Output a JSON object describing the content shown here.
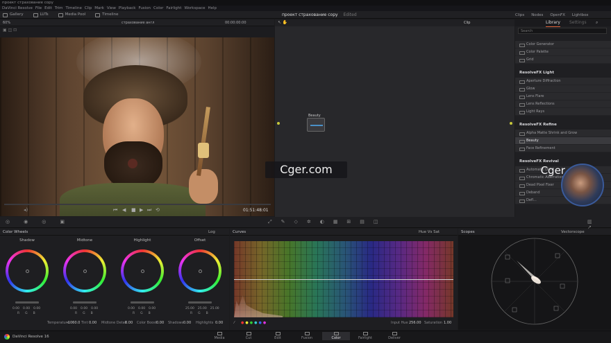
{
  "window": {
    "title": "проект страхование copy"
  },
  "menu": [
    "DaVinci Resolve",
    "File",
    "Edit",
    "Trim",
    "Timeline",
    "Clip",
    "Mark",
    "View",
    "Playback",
    "Fusion",
    "Color",
    "Fairlight",
    "Workspace",
    "Help"
  ],
  "toolbar": {
    "left": [
      "Gallery",
      "LUTs",
      "Media Pool",
      "Timeline"
    ],
    "project_title": "проект страхование copy",
    "project_status": "Edited",
    "right": [
      "Clips",
      "Nodes",
      "OpenFX",
      "Lightbox"
    ]
  },
  "viewer": {
    "zoom": "60%",
    "clip_name": "страхование англ",
    "timecode_top": "00:00:00:00",
    "timecode": "01:51:48:01"
  },
  "node_editor": {
    "mode": "Clip",
    "node_label": "Beauty"
  },
  "library": {
    "tabs": [
      "Library",
      "Settings"
    ],
    "search_placeholder": "Search",
    "groups": [
      {
        "header": "",
        "items": [
          "Color Generator",
          "Color Palette",
          "Grid"
        ]
      },
      {
        "header": "ResolveFX Light",
        "items": [
          "Aperture Diffraction",
          "Glow",
          "Lens Flare",
          "Lens Reflections",
          "Light Rays"
        ]
      },
      {
        "header": "ResolveFX Refine",
        "items": [
          "Alpha Matte Shrink and Grow",
          "Beauty",
          "Face Refinement"
        ]
      },
      {
        "header": "ResolveFX Revival",
        "items": [
          "Automatic Dirt",
          "Chromatic Aberration",
          "Dead Pixel Fixer",
          "Deband",
          "Defl..."
        ]
      }
    ],
    "selected": "Beauty"
  },
  "watermark": "Cger.com",
  "color_wheels": {
    "title": "Color Wheels",
    "mode": "Log",
    "wheels": [
      {
        "name": "Shadow",
        "values": [
          "0.00",
          "0.00",
          "0.00"
        ]
      },
      {
        "name": "Midtone",
        "values": [
          "0.00",
          "0.00",
          "0.00"
        ]
      },
      {
        "name": "Highlight",
        "values": [
          "0.00",
          "0.00",
          "0.00"
        ]
      },
      {
        "name": "Offset",
        "values": [
          "25.00",
          "25.00",
          "25.00"
        ]
      }
    ],
    "channel_letters": [
      "R",
      "G",
      "B"
    ],
    "params": [
      {
        "label": "Temperature",
        "value": "-1060.0"
      },
      {
        "label": "Tint",
        "value": "0.00"
      },
      {
        "label": "Midtone Detail",
        "value": "0.00"
      },
      {
        "label": "Color Boost",
        "value": "0.00"
      },
      {
        "label": "Shadows",
        "value": "0.00"
      },
      {
        "label": "Highlights",
        "value": "0.00"
      }
    ]
  },
  "curves": {
    "title": "Curves",
    "mode": "Hue Vs Sat",
    "input_hue_label": "Input Hue",
    "input_hue": "256.00",
    "saturation_label": "Saturation",
    "saturation": "1.00"
  },
  "scopes": {
    "title": "Scopes",
    "mode": "Vectorscope"
  },
  "app": {
    "name": "DaVinci Resolve 16"
  },
  "pages": [
    "Media",
    "Cut",
    "Edit",
    "Fusion",
    "Color",
    "Fairlight",
    "Deliver"
  ],
  "active_page": "Color",
  "colors": {
    "accent": "#e0643a",
    "bg": "#1b1b1d",
    "panel": "#262629"
  }
}
